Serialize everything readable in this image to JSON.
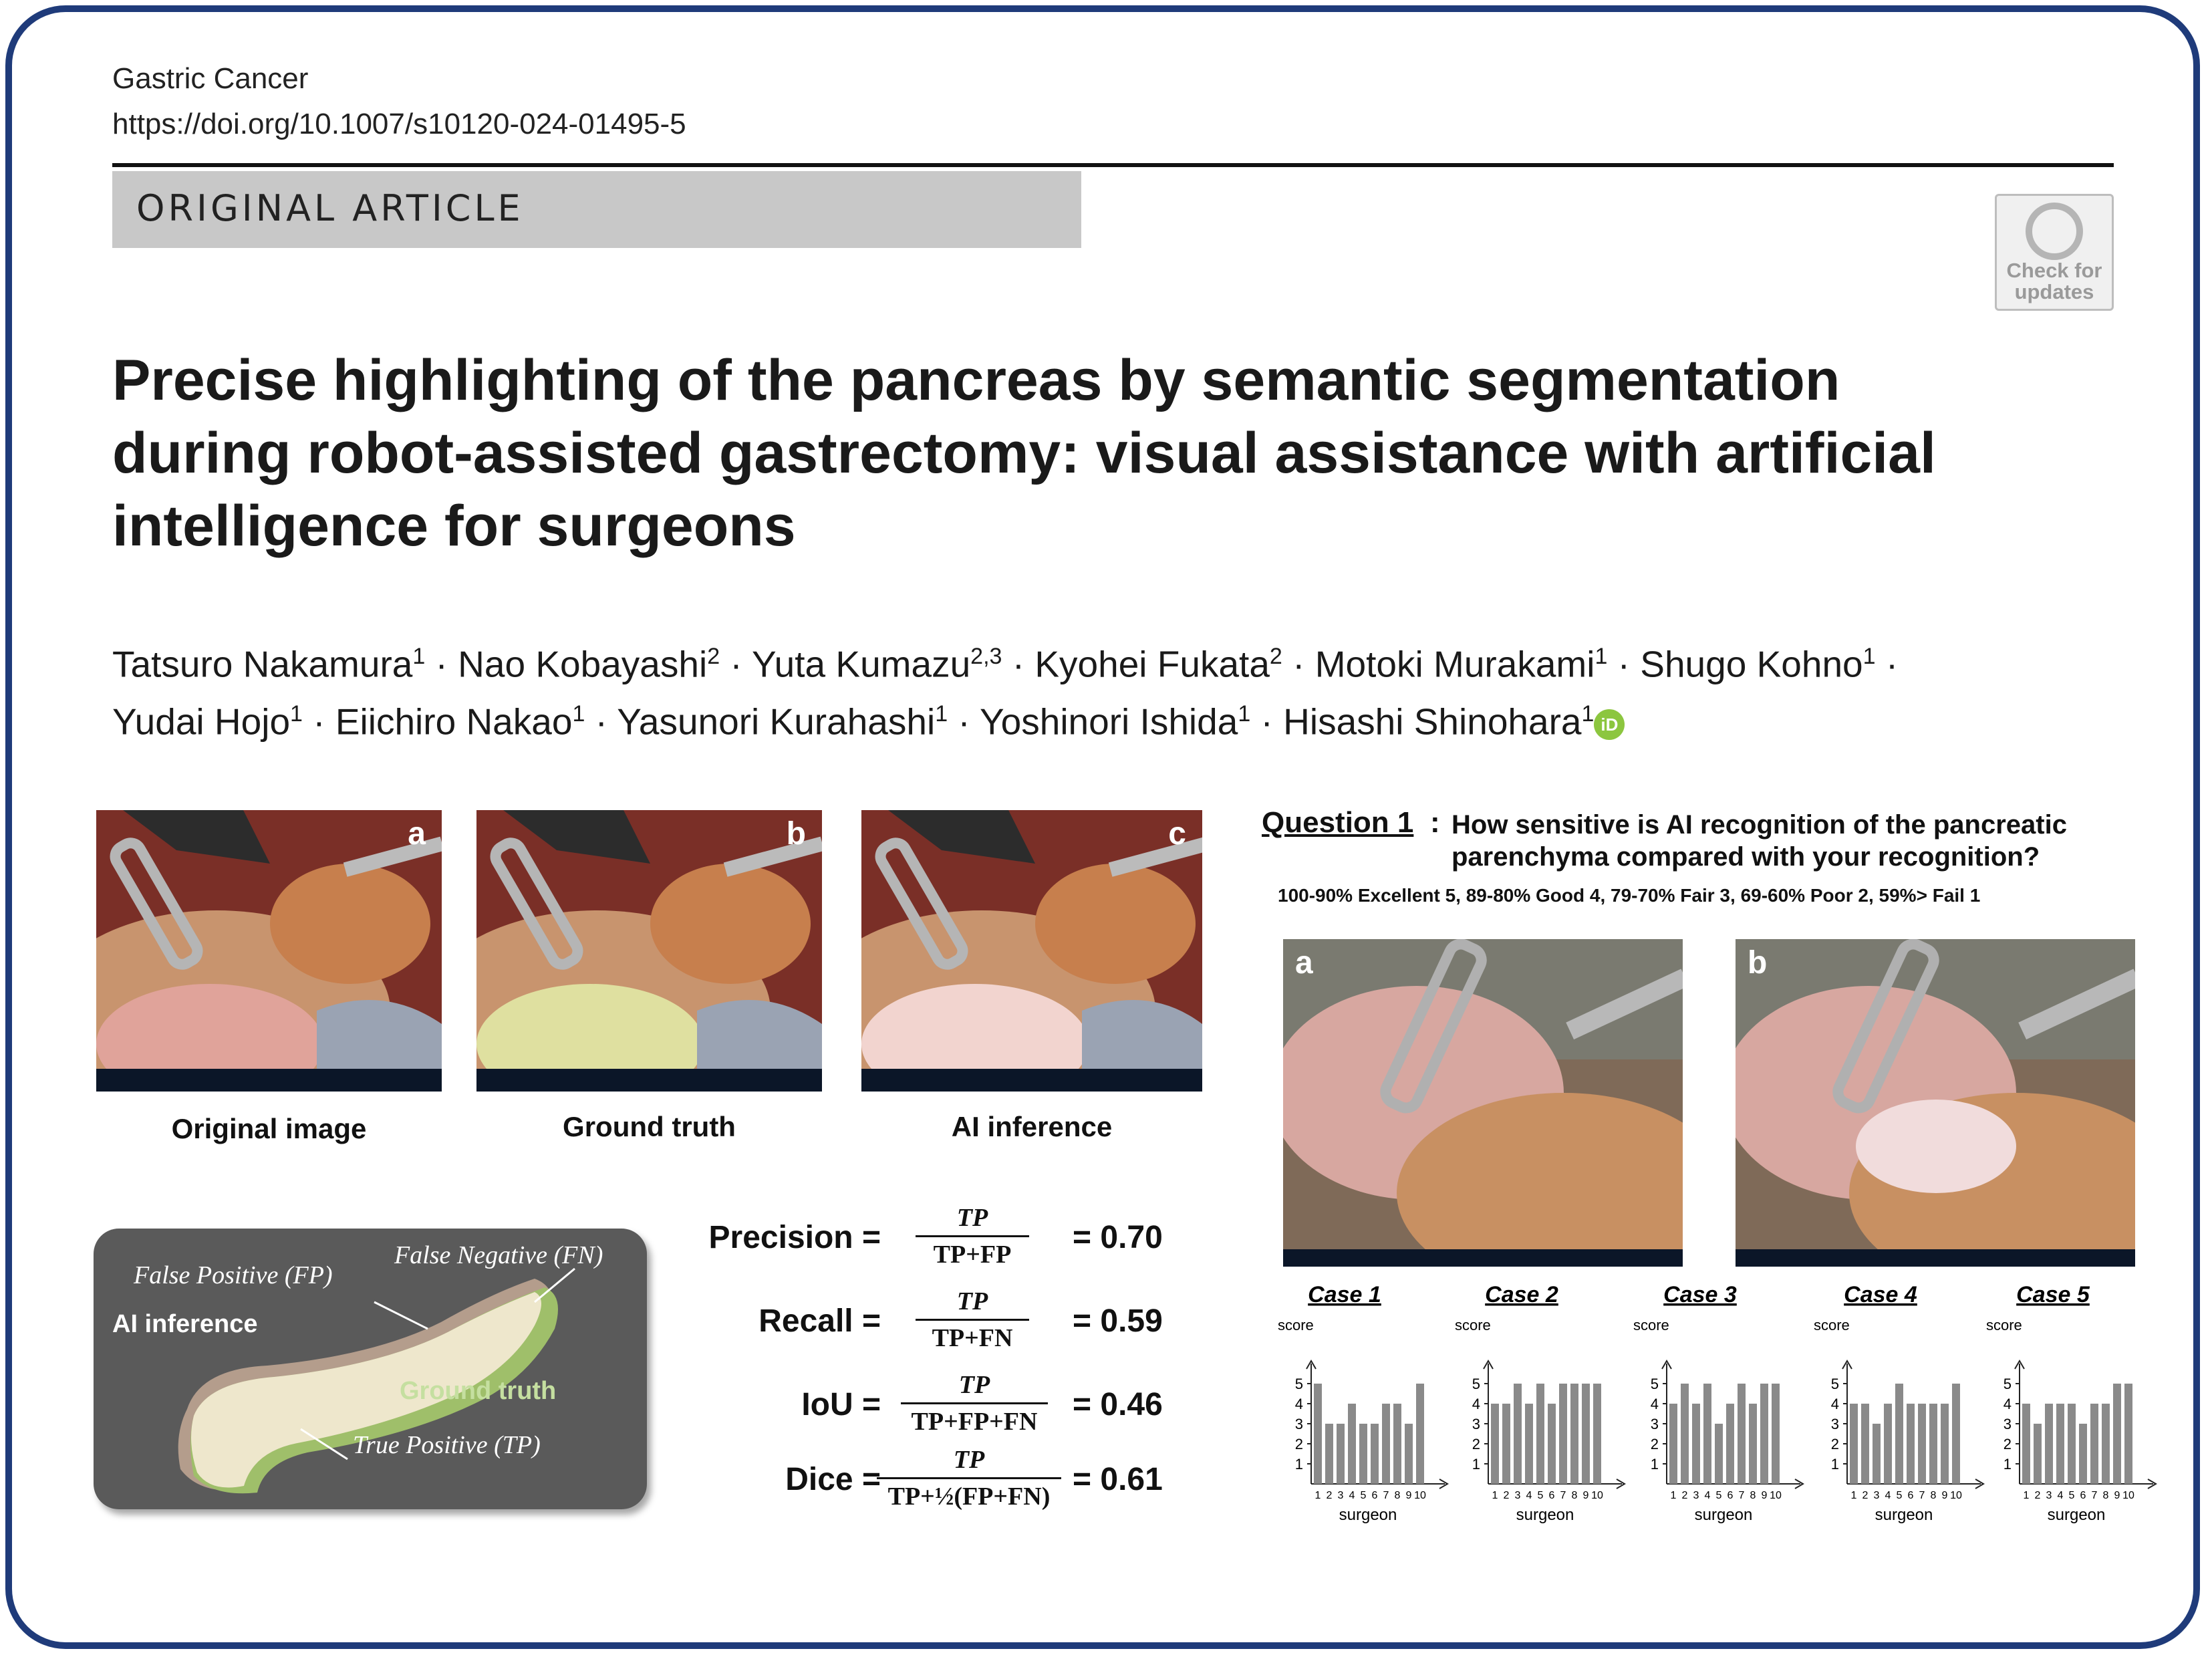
{
  "journal": {
    "name": "Gastric Cancer",
    "doi": "https://doi.org/10.1007/s10120-024-01495-5"
  },
  "article_type": "ORIGINAL ARTICLE",
  "check_updates": {
    "line1": "Check for",
    "line2": "updates"
  },
  "title_lines": [
    "Precise highlighting of the pancreas by semantic segmentation",
    "during robot-assisted gastrectomy: visual assistance with artificial",
    "intelligence for surgeons"
  ],
  "authors_line1": [
    {
      "name": "Tatsuro Nakamura",
      "aff": "1"
    },
    {
      "name": "Nao Kobayashi",
      "aff": "2"
    },
    {
      "name": "Yuta Kumazu",
      "aff": "2,3"
    },
    {
      "name": "Kyohei Fukata",
      "aff": "2"
    },
    {
      "name": "Motoki Murakami",
      "aff": "1"
    },
    {
      "name": "Shugo Kohno",
      "aff": "1"
    }
  ],
  "authors_line2": [
    {
      "name": "Yudai Hojo",
      "aff": "1"
    },
    {
      "name": "Eiichiro Nakao",
      "aff": "1"
    },
    {
      "name": "Yasunori Kurahashi",
      "aff": "1"
    },
    {
      "name": "Yoshinori Ishida",
      "aff": "1"
    },
    {
      "name": "Hisashi Shinohara",
      "aff": "1"
    }
  ],
  "orcid_label": "iD",
  "panels": [
    {
      "letter": "a",
      "caption": "Original image"
    },
    {
      "letter": "b",
      "caption": "Ground truth"
    },
    {
      "letter": "c",
      "caption": "AI inference"
    }
  ],
  "diagram": {
    "fp": "False Positive (FP)",
    "fn": "False Negative (FN)",
    "ai": "AI inference",
    "gt": "Ground truth",
    "tp": "True Positive (TP)"
  },
  "metrics": [
    {
      "label": "Precision =",
      "num": "TP",
      "den": "TP+FP",
      "value": "= 0.70"
    },
    {
      "label": "Recall =",
      "num": "TP",
      "den": "TP+FN",
      "value": "= 0.59"
    },
    {
      "label": "IoU =",
      "num": "TP",
      "den": "TP+FP+FN",
      "value": "= 0.46"
    },
    {
      "label": "Dice =",
      "num": "TP",
      "den": "TP+½(FP+FN)",
      "value": "= 0.61"
    }
  ],
  "question": {
    "label": "Question 1",
    "colon": ":",
    "line1": "How sensitive is AI recognition of the pancreatic",
    "line2": "parenchyma compared with your recognition?",
    "scale": "100-90% Excellent 5, 89-80% Good 4, 79-70% Fair 3, 69-60% Poor 2, 59%> Fail 1"
  },
  "photos": [
    {
      "letter": "a"
    },
    {
      "letter": "b"
    }
  ],
  "chart_data": [
    {
      "type": "bar",
      "title": "Case 1",
      "xlabel": "surgeon",
      "ylabel": "score",
      "ylim": [
        0,
        5
      ],
      "categories": [
        "1",
        "2",
        "3",
        "4",
        "5",
        "6",
        "7",
        "8",
        "9",
        "10"
      ],
      "values": [
        5,
        3,
        3,
        4,
        3,
        3,
        4,
        4,
        3,
        5
      ]
    },
    {
      "type": "bar",
      "title": "Case 2",
      "xlabel": "surgeon",
      "ylabel": "score",
      "ylim": [
        0,
        5
      ],
      "categories": [
        "1",
        "2",
        "3",
        "4",
        "5",
        "6",
        "7",
        "8",
        "9",
        "10"
      ],
      "values": [
        4,
        4,
        5,
        4,
        5,
        4,
        5,
        5,
        5,
        5
      ]
    },
    {
      "type": "bar",
      "title": "Case 3",
      "xlabel": "surgeon",
      "ylabel": "score",
      "ylim": [
        0,
        5
      ],
      "categories": [
        "1",
        "2",
        "3",
        "4",
        "5",
        "6",
        "7",
        "8",
        "9",
        "10"
      ],
      "values": [
        4,
        5,
        4,
        5,
        3,
        4,
        5,
        4,
        5,
        5
      ]
    },
    {
      "type": "bar",
      "title": "Case 4",
      "xlabel": "surgeon",
      "ylabel": "score",
      "ylim": [
        0,
        5
      ],
      "categories": [
        "1",
        "2",
        "3",
        "4",
        "5",
        "6",
        "7",
        "8",
        "9",
        "10"
      ],
      "values": [
        4,
        4,
        3,
        4,
        5,
        4,
        4,
        4,
        4,
        5
      ]
    },
    {
      "type": "bar",
      "title": "Case 5",
      "xlabel": "surgeon",
      "ylabel": "score",
      "ylim": [
        0,
        5
      ],
      "categories": [
        "1",
        "2",
        "3",
        "4",
        "5",
        "6",
        "7",
        "8",
        "9",
        "10"
      ],
      "values": [
        4,
        3,
        4,
        4,
        4,
        3,
        4,
        4,
        5,
        5
      ]
    }
  ]
}
